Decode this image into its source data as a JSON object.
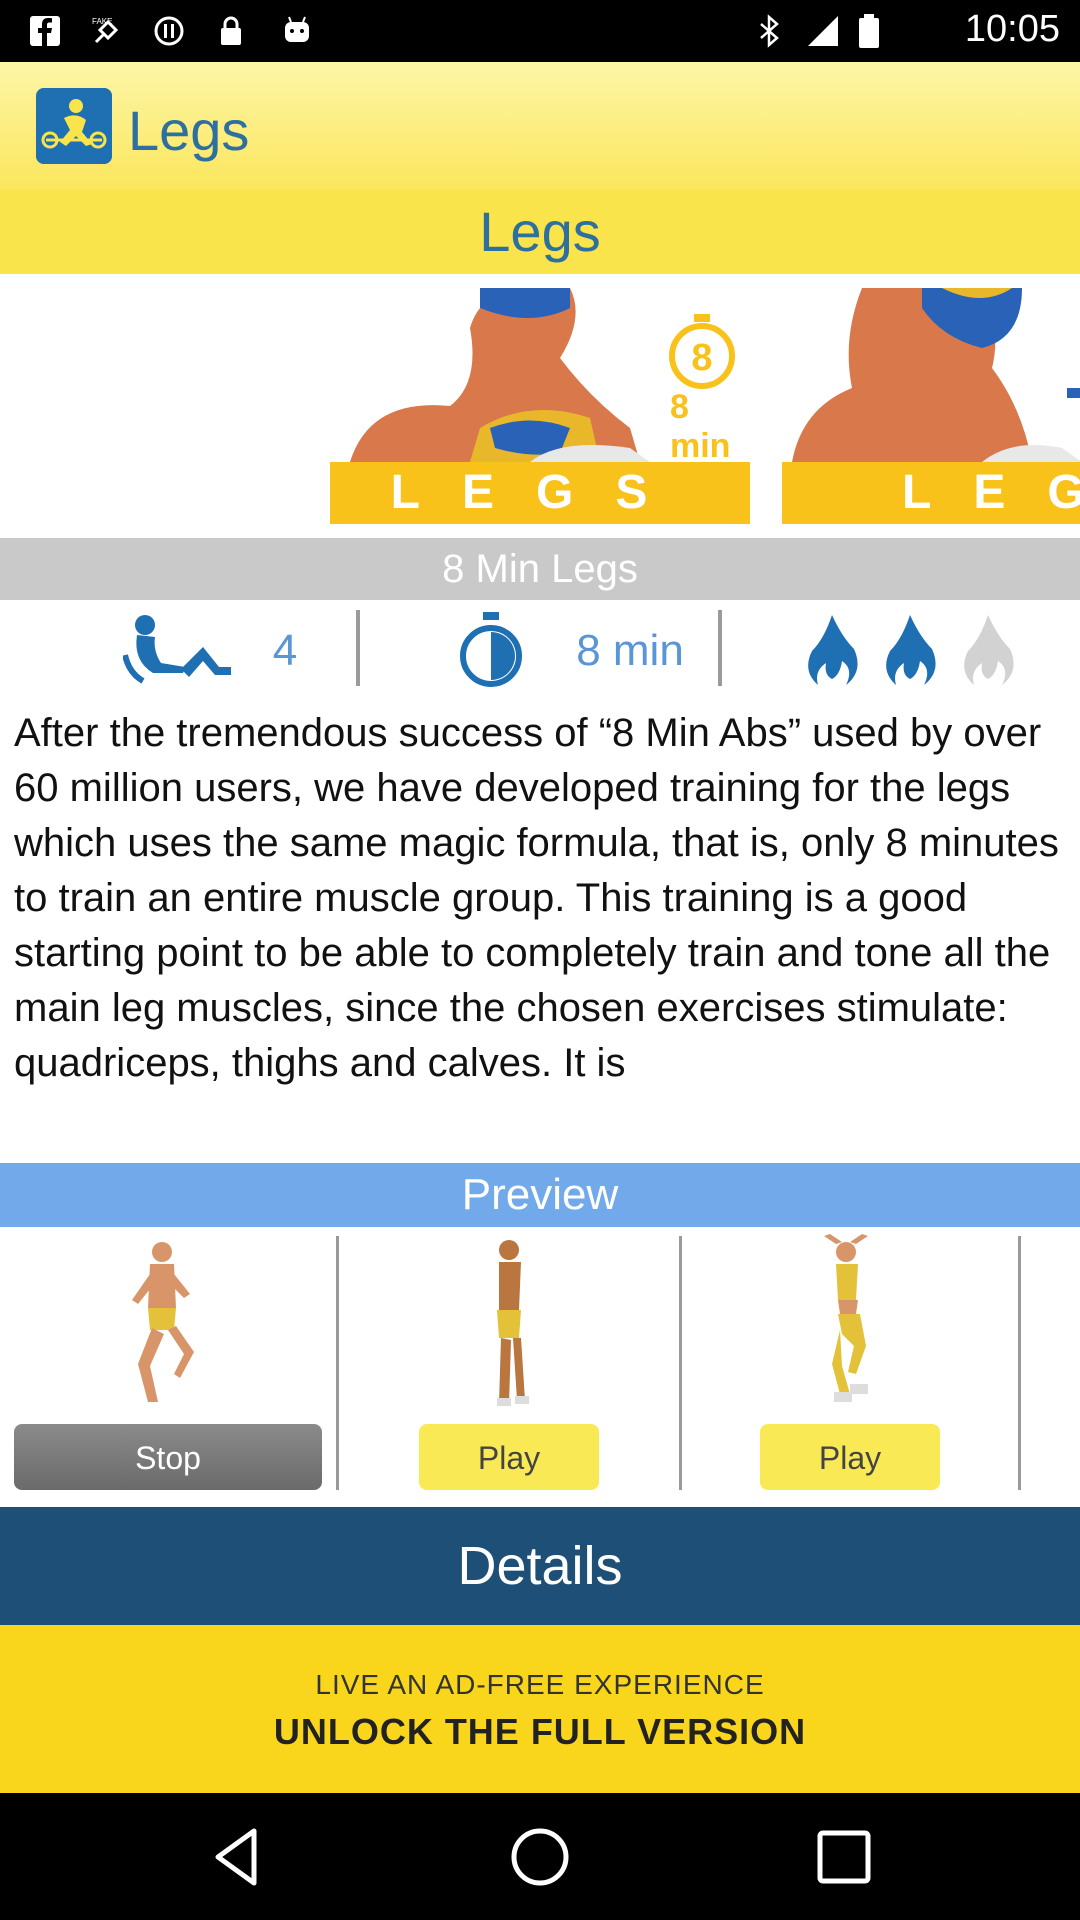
{
  "status_bar": {
    "time": "10:05",
    "icons": [
      "facebook-icon",
      "fake-gps-icon",
      "sync-icon",
      "lock-icon",
      "android-icon",
      "bluetooth-icon",
      "signal-icon",
      "battery-icon"
    ]
  },
  "app_bar": {
    "title": "Legs",
    "icon": "weightlifter-icon"
  },
  "subtitle": "Legs",
  "banners": [
    {
      "label": "LEGS",
      "badge": "8 min"
    },
    {
      "label": "LEGS",
      "badge": ""
    }
  ],
  "workout": {
    "title": "8 Min Legs",
    "exercises_count": "4",
    "duration": "8 min",
    "difficulty": {
      "filled": 2,
      "total": 3
    }
  },
  "description": "After the tremendous success of “8 Min Abs” used by over 60 million users, we have developed training for the legs which uses the same magic formula, that is, only 8 minutes to train an entire muscle group. This training is a good starting point to be able to completely train and tone all the main leg muscles, since the chosen exercises stimulate: quadriceps, thighs and calves. It is",
  "preview": {
    "title": "Preview",
    "items": [
      {
        "button": "Stop"
      },
      {
        "button": "Play"
      },
      {
        "button": "Play"
      }
    ]
  },
  "details_label": "Details",
  "ad": {
    "line1": "LIVE AN AD-FREE EXPERIENCE",
    "line2": "UNLOCK THE FULL VERSION"
  },
  "nav": [
    "back-icon",
    "home-icon",
    "recents-icon"
  ],
  "colors": {
    "accent_blue": "#2d6f9e",
    "yellow": "#f9e44c",
    "preview_blue": "#72a9ea",
    "details_blue": "#1e4f76",
    "stat_blue": "#5a96d6"
  }
}
